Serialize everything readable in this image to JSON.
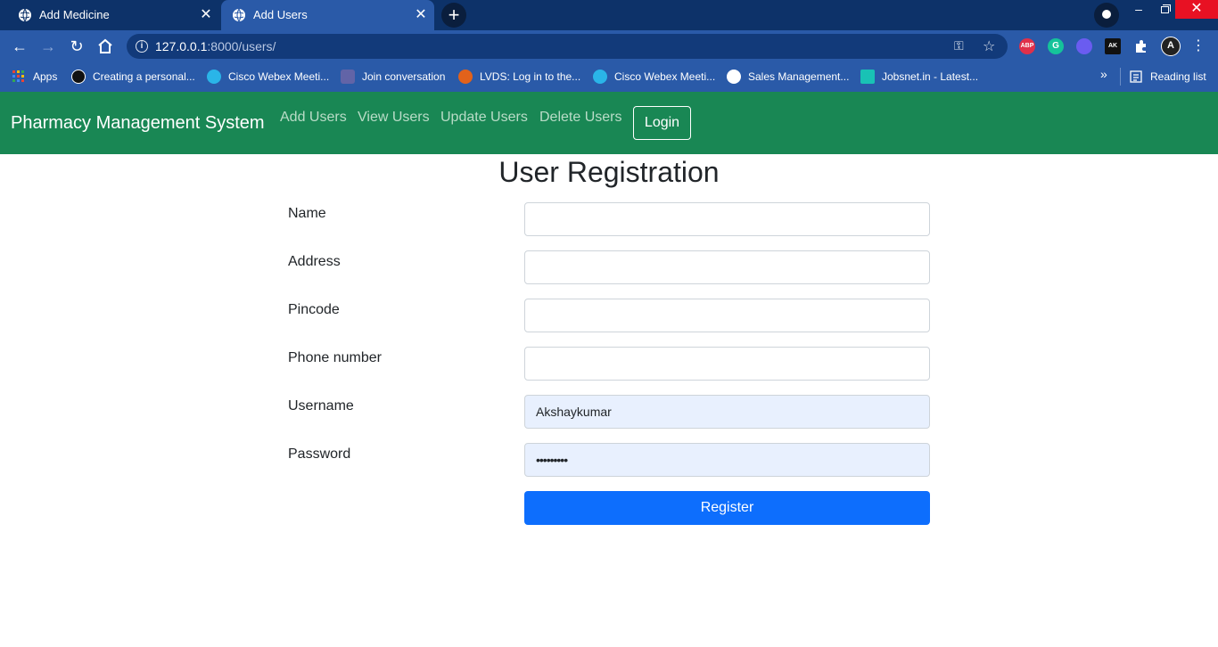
{
  "browser": {
    "tabs": [
      {
        "title": "Add Medicine",
        "active": false
      },
      {
        "title": "Add Users",
        "active": true
      }
    ],
    "new_tab_label": "+",
    "close_glyph": "✕",
    "url_host": "127.0.0.1",
    "url_path": ":8000/users/",
    "extensions": [
      {
        "name": "adblock-plus-icon",
        "label": "ABP",
        "color": "#e0304a"
      },
      {
        "name": "grammarly-icon",
        "label": "G",
        "color": "#15c39a"
      },
      {
        "name": "extension-gear-icon",
        "label": "",
        "color": "#6a5cf0"
      },
      {
        "name": "ak-extension-icon",
        "label": "AK",
        "color": "#111111"
      },
      {
        "name": "puzzle-icon",
        "label": "",
        "color": "#2a5aa8"
      },
      {
        "name": "profile-avatar-icon",
        "label": "",
        "color": "#222222"
      }
    ],
    "bookmarks": [
      {
        "label": "Apps",
        "icon": "apps-grid-icon",
        "color": "#f4b400"
      },
      {
        "label": "Creating a personal...",
        "icon": "github-icon",
        "color": "#111111"
      },
      {
        "label": "Cisco Webex Meeti...",
        "icon": "webex-icon",
        "color": "#2ab5e8"
      },
      {
        "label": "Join conversation",
        "icon": "teams-icon",
        "color": "#6264a7"
      },
      {
        "label": "LVDS: Log in to the...",
        "icon": "info-orange-icon",
        "color": "#e2621b"
      },
      {
        "label": "Cisco Webex Meeti...",
        "icon": "webex-icon",
        "color": "#2ab5e8"
      },
      {
        "label": "Sales Management...",
        "icon": "globe-icon",
        "color": "#ffffff"
      },
      {
        "label": "Jobsnet.in - Latest...",
        "icon": "jobsnet-icon",
        "color": "#19c2b5"
      }
    ],
    "overflow_glyph": "»",
    "reading_list": "Reading list"
  },
  "navbar": {
    "brand": "Pharmacy Management System",
    "links": [
      "Add Users",
      "View Users",
      "Update Users",
      "Delete Users"
    ],
    "login": "Login",
    "bg_color": "#198754"
  },
  "form": {
    "title": "User Registration",
    "fields": [
      {
        "label": "Name",
        "value": ""
      },
      {
        "label": "Address",
        "value": ""
      },
      {
        "label": "Pincode",
        "value": ""
      },
      {
        "label": "Phone number",
        "value": ""
      },
      {
        "label": "Username",
        "value": "Akshaykumar"
      },
      {
        "label": "Password",
        "value": "•••••••••"
      }
    ],
    "submit": "Register",
    "submit_color": "#0d6efd"
  }
}
